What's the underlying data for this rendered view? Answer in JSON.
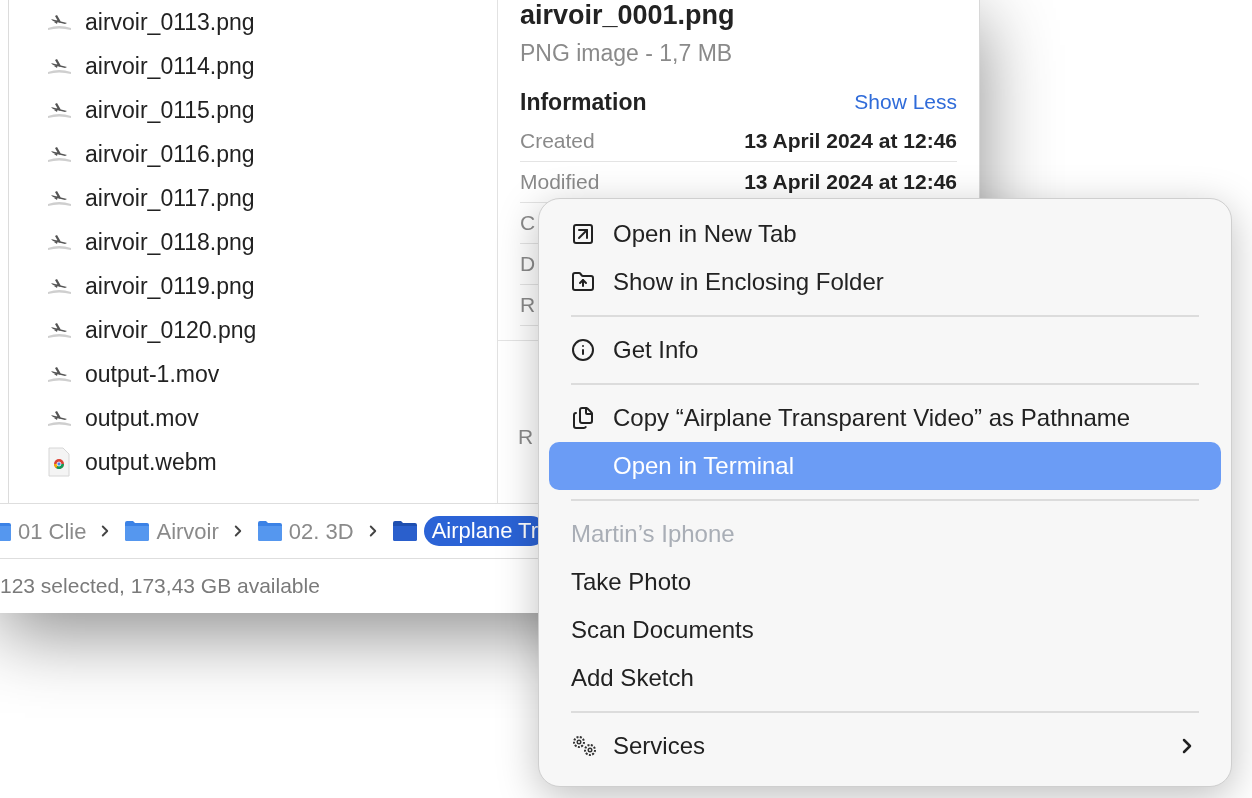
{
  "files": [
    {
      "name": "airvoir_0113.png",
      "kind": "plane"
    },
    {
      "name": "airvoir_0114.png",
      "kind": "plane"
    },
    {
      "name": "airvoir_0115.png",
      "kind": "plane"
    },
    {
      "name": "airvoir_0116.png",
      "kind": "plane"
    },
    {
      "name": "airvoir_0117.png",
      "kind": "plane"
    },
    {
      "name": "airvoir_0118.png",
      "kind": "plane"
    },
    {
      "name": "airvoir_0119.png",
      "kind": "plane"
    },
    {
      "name": "airvoir_0120.png",
      "kind": "plane"
    },
    {
      "name": "output-1.mov",
      "kind": "plane"
    },
    {
      "name": "output.mov",
      "kind": "plane"
    },
    {
      "name": "output.webm",
      "kind": "web"
    }
  ],
  "preview": {
    "title": "airvoir_0001.png",
    "subtitle": "PNG image - 1,7 MB",
    "section_title": "Information",
    "toggle_link": "Show Less",
    "info_rows": [
      {
        "label": "Created",
        "value": "13 April 2024 at 12:46"
      },
      {
        "label": "Modified",
        "value": "13 April 2024 at 12:46"
      },
      {
        "label": "C"
      },
      {
        "label": "D"
      },
      {
        "label": "R"
      }
    ],
    "footer_text": "R"
  },
  "path_bar": [
    {
      "name": "01 Clie",
      "selected": false
    },
    {
      "name": "Airvoir",
      "selected": false
    },
    {
      "name": "02. 3D",
      "selected": false
    },
    {
      "name": "Airplane Tr",
      "selected": true
    }
  ],
  "status_bar": "123 selected, 173,43 GB available",
  "context_menu": [
    {
      "kind": "tab",
      "label": "Open in New Tab",
      "selected": false
    },
    {
      "kind": "reveal",
      "label": "Show in Enclosing Folder",
      "selected": false
    },
    {
      "kind": "separator"
    },
    {
      "kind": "info",
      "label": "Get Info",
      "selected": false
    },
    {
      "kind": "separator"
    },
    {
      "kind": "copy",
      "label": "Copy “Airplane Transparent Video” as Pathname",
      "selected": false
    },
    {
      "kind": "item",
      "label": "Open in Terminal",
      "selected": true
    },
    {
      "kind": "separator"
    },
    {
      "kind": "header",
      "label": "Martin’s Iphone"
    },
    {
      "kind": "item",
      "label": "Take Photo",
      "selected": false
    },
    {
      "kind": "item",
      "label": "Scan Documents",
      "selected": false
    },
    {
      "kind": "item",
      "label": "Add Sketch",
      "selected": false
    },
    {
      "kind": "separator"
    },
    {
      "kind": "services",
      "label": "Services",
      "selected": false
    }
  ]
}
